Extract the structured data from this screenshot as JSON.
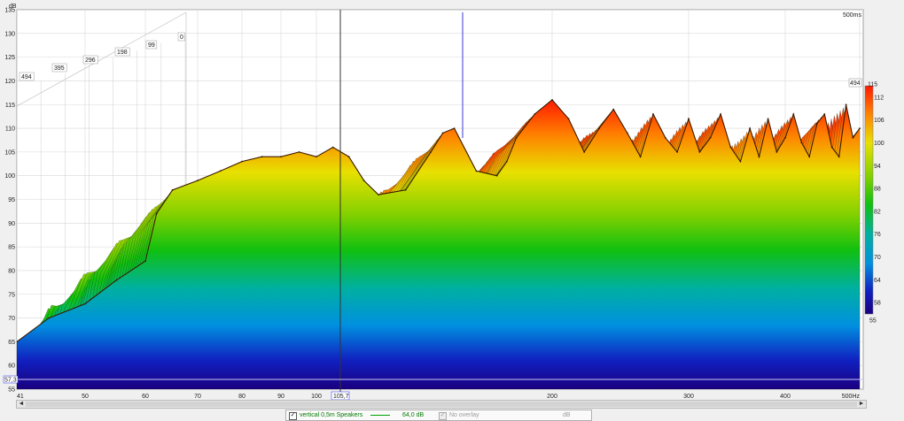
{
  "chart_data": {
    "type": "area",
    "title": "",
    "ylabel": "dB",
    "xunit": "Hz",
    "xlim": [
      41,
      500
    ],
    "ylim": [
      55,
      135
    ],
    "x_ticks": [
      "41",
      "50",
      "60",
      "70",
      "80",
      "90",
      "100",
      "200",
      "300",
      "400",
      "500Hz"
    ],
    "y_ticks": [
      "135",
      "130",
      "125",
      "120",
      "115",
      "110",
      "105",
      "100",
      "95",
      "90",
      "85",
      "80",
      "75",
      "70",
      "65",
      "60",
      "55"
    ],
    "time_labels": [
      "494",
      "395",
      "296",
      "198",
      "99",
      "0"
    ],
    "time_axis_top_label": "500ms",
    "right_axis_label": "494",
    "cursor_freq_label": "105,7",
    "cursor_level_label": "57,3",
    "colorbar_ticks": [
      "115",
      "112",
      "106",
      "100",
      "94",
      "88",
      "82",
      "76",
      "70",
      "64",
      "58",
      "55"
    ],
    "colorbar_range": [
      55,
      115
    ],
    "series": [
      {
        "name": "vertical 0,5m Speakers",
        "color": "#00a000",
        "x": [
          41,
          45,
          50,
          55,
          60,
          62,
          65,
          70,
          75,
          80,
          85,
          90,
          95,
          100,
          105,
          110,
          115,
          120,
          130,
          140,
          145,
          150,
          160,
          170,
          175,
          180,
          190,
          200,
          210,
          220,
          230,
          240,
          250,
          260,
          270,
          280,
          290,
          300,
          310,
          320,
          330,
          340,
          350,
          360,
          370,
          380,
          390,
          400,
          410,
          420,
          430,
          440,
          450,
          460,
          470,
          480,
          490,
          500
        ],
        "y": [
          65,
          70,
          73,
          78,
          82,
          92,
          97,
          99,
          101,
          103,
          104,
          104,
          105,
          104,
          106,
          104,
          99,
          96,
          97,
          105,
          109,
          110,
          101,
          100,
          103,
          108,
          113,
          116,
          112,
          105,
          110,
          114,
          109,
          104,
          113,
          108,
          105,
          112,
          105,
          108,
          113,
          106,
          103,
          110,
          104,
          112,
          105,
          108,
          113,
          107,
          104,
          111,
          113,
          106,
          104,
          115,
          108,
          110
        ]
      }
    ],
    "grid": true
  },
  "ui": {
    "scroll_left": "◄",
    "scroll_right": "►",
    "legend_check": "✓",
    "legend_trace_name": "vertical 0,5m Speakers",
    "legend_trace_value": "64,0 dB",
    "legend_overlay": "No overlay",
    "legend_overlay_unit": "dB"
  }
}
